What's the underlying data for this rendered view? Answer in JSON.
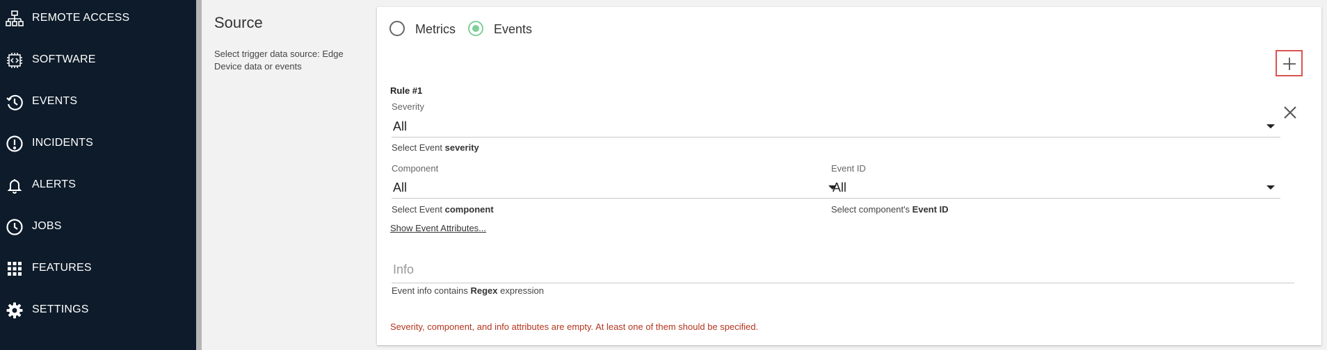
{
  "sidebar": {
    "items": [
      {
        "label": "REMOTE ACCESS",
        "icon": "network-icon"
      },
      {
        "label": "SOFTWARE",
        "icon": "chip-code-icon"
      },
      {
        "label": "EVENTS",
        "icon": "history-icon"
      },
      {
        "label": "INCIDENTS",
        "icon": "alert-circle-icon"
      },
      {
        "label": "ALERTS",
        "icon": "bell-icon"
      },
      {
        "label": "JOBS",
        "icon": "clock-icon"
      },
      {
        "label": "FEATURES",
        "icon": "grid-icon"
      },
      {
        "label": "SETTINGS",
        "icon": "gear-icon"
      }
    ]
  },
  "section": {
    "title": "Source",
    "description": "Select trigger data source: Edge Device data or events"
  },
  "source_type": {
    "options": [
      "Metrics",
      "Events"
    ],
    "selected": "Events"
  },
  "rule": {
    "title": "Rule #1",
    "severity": {
      "label": "Severity",
      "value": "All",
      "helper_prefix": "Select Event ",
      "helper_bold": "severity"
    },
    "component": {
      "label": "Component",
      "value": "All",
      "helper_prefix": "Select Event ",
      "helper_bold": "component"
    },
    "event_id": {
      "label": "Event ID",
      "value": "All",
      "helper_prefix": "Select component's ",
      "helper_bold": "Event ID"
    },
    "show_attributes_link": "Show Event Attributes...",
    "info": {
      "placeholder": "Info",
      "value": "",
      "helper_prefix": "Event info contains ",
      "helper_bold": "Regex",
      "helper_suffix": " expression"
    },
    "error": "Severity, component, and info attributes are empty. At least one of them should be specified."
  },
  "colors": {
    "sidebar_bg": "#0d1b2a",
    "radio_accent": "#7fcf99",
    "error_text": "#b3351f",
    "add_button_border": "#d9534f"
  }
}
